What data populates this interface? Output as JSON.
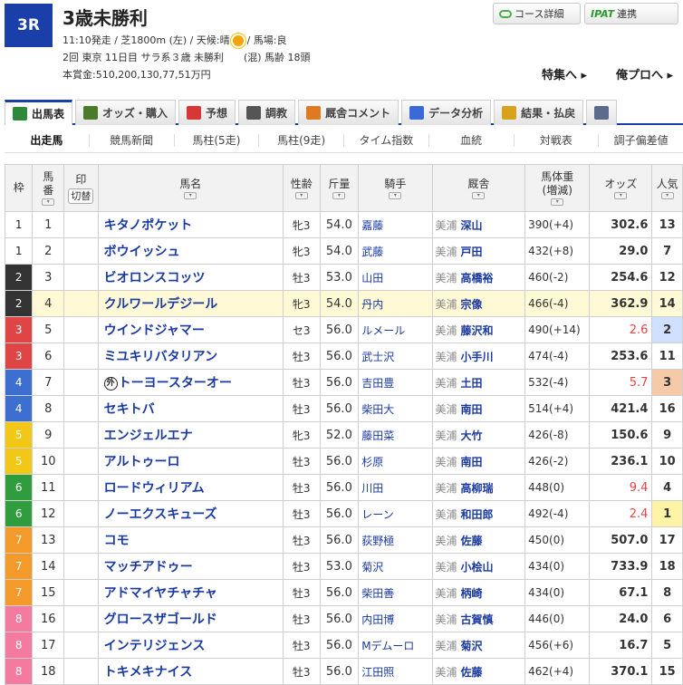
{
  "header": {
    "race_number": "3R",
    "race_name": "3歳未勝利",
    "buttons": {
      "course_detail": "コース詳細",
      "ipat_logo": "IPAT",
      "ipat_label": "連携"
    },
    "info_line1_a": "11:10発走 / 芝1800m (左) / 天候:晴",
    "info_line1_b": "/ 馬場:良",
    "info_line2": "2回 東京 11日目 サラ系３歳 未勝利　　(混) 馬齢 18頭",
    "info_line3": "本賞金:510,200,130,77,51万円",
    "links": {
      "tokushu": "特集へ",
      "orepro": "俺プロへ"
    }
  },
  "tabs": [
    {
      "label": "出馬表",
      "icon": "table-icon",
      "icon_color": "#2c8a3a"
    },
    {
      "label": "オッズ・購入",
      "icon": "odds-icon",
      "icon_color": "#4a7a2a"
    },
    {
      "label": "予想",
      "icon": "target-icon",
      "icon_color": "#d93636"
    },
    {
      "label": "調教",
      "icon": "stopwatch-icon",
      "icon_color": "#555555"
    },
    {
      "label": "厩舎コメント",
      "icon": "barn-icon",
      "icon_color": "#e07a22"
    },
    {
      "label": "データ分析",
      "icon": "bar-chart-icon",
      "icon_color": "#3a6ad8"
    },
    {
      "label": "結果・払戻",
      "icon": "coins-icon",
      "icon_color": "#d8a21c"
    },
    {
      "label": "",
      "icon": "video-icon",
      "icon_color": "#5a6a8a"
    }
  ],
  "subnav": [
    "出走馬",
    "競馬新聞",
    "馬柱(5走)",
    "馬柱(9走)",
    "タイム指数",
    "血統",
    "対戦表",
    "調子偏差値"
  ],
  "table": {
    "headers": {
      "waku": "枠",
      "umaban_1": "馬",
      "umaban_2": "番",
      "mark_1": "印",
      "mark_2": "切替",
      "horse": "馬名",
      "sexage": "性齢",
      "kinryo": "斤量",
      "jockey": "騎手",
      "trainer": "厩舎",
      "weight_1": "馬体重",
      "weight_2": "(増減)",
      "odds": "オッズ",
      "pop": "人気"
    },
    "rows": [
      {
        "waku": "1",
        "umaban": "1",
        "horse": "キタノポケット",
        "sexage": "牝3",
        "kinryo": "54.0",
        "jockey": "嘉藤",
        "region": "美浦",
        "trainer": "深山",
        "weight": "390(+4)",
        "odds": "302.6",
        "pop": "13"
      },
      {
        "waku": "1",
        "umaban": "2",
        "horse": "ボウイッシュ",
        "sexage": "牝3",
        "kinryo": "54.0",
        "jockey": "武藤",
        "region": "美浦",
        "trainer": "戸田",
        "weight": "432(+8)",
        "odds": "29.0",
        "pop": "7"
      },
      {
        "waku": "2",
        "umaban": "3",
        "horse": "ビオロンスコッツ",
        "sexage": "牡3",
        "kinryo": "53.0",
        "jockey": "山田",
        "region": "美浦",
        "trainer": "高橋裕",
        "weight": "460(-2)",
        "odds": "254.6",
        "pop": "12"
      },
      {
        "waku": "2",
        "umaban": "4",
        "horse": "クルワールデジール",
        "sexage": "牝3",
        "kinryo": "54.0",
        "jockey": "丹内",
        "region": "美浦",
        "trainer": "宗像",
        "weight": "466(-4)",
        "odds": "362.9",
        "pop": "14"
      },
      {
        "waku": "3",
        "umaban": "5",
        "horse": "ウインドジャマー",
        "sexage": "セ3",
        "kinryo": "56.0",
        "jockey": "ルメール",
        "region": "美浦",
        "trainer": "藤沢和",
        "weight": "490(+14)",
        "odds": "2.6",
        "pop": "2"
      },
      {
        "waku": "3",
        "umaban": "6",
        "horse": "ミユキリバタリアン",
        "sexage": "牡3",
        "kinryo": "56.0",
        "jockey": "武士沢",
        "region": "美浦",
        "trainer": "小手川",
        "weight": "474(-4)",
        "odds": "253.6",
        "pop": "11"
      },
      {
        "waku": "4",
        "umaban": "7",
        "horse": "トーヨースターオー",
        "sexage": "牡3",
        "kinryo": "56.0",
        "jockey": "吉田豊",
        "region": "美浦",
        "trainer": "土田",
        "weight": "532(-4)",
        "odds": "5.7",
        "pop": "3",
        "foreign": "外"
      },
      {
        "waku": "4",
        "umaban": "8",
        "horse": "セキトバ",
        "sexage": "牡3",
        "kinryo": "56.0",
        "jockey": "柴田大",
        "region": "美浦",
        "trainer": "南田",
        "weight": "514(+4)",
        "odds": "421.4",
        "pop": "16"
      },
      {
        "waku": "5",
        "umaban": "9",
        "horse": "エンジェルエナ",
        "sexage": "牝3",
        "kinryo": "52.0",
        "jockey": "藤田菜",
        "region": "美浦",
        "trainer": "大竹",
        "weight": "426(-8)",
        "odds": "150.6",
        "pop": "9"
      },
      {
        "waku": "5",
        "umaban": "10",
        "horse": "アルトゥーロ",
        "sexage": "牡3",
        "kinryo": "56.0",
        "jockey": "杉原",
        "region": "美浦",
        "trainer": "南田",
        "weight": "426(-2)",
        "odds": "236.1",
        "pop": "10"
      },
      {
        "waku": "6",
        "umaban": "11",
        "horse": "ロードウィリアム",
        "sexage": "牡3",
        "kinryo": "56.0",
        "jockey": "川田",
        "region": "美浦",
        "trainer": "高柳瑞",
        "weight": "448(0)",
        "odds": "9.4",
        "pop": "4"
      },
      {
        "waku": "6",
        "umaban": "12",
        "horse": "ノーエクスキューズ",
        "sexage": "牡3",
        "kinryo": "56.0",
        "jockey": "レーン",
        "region": "美浦",
        "trainer": "和田郎",
        "weight": "492(-4)",
        "odds": "2.4",
        "pop": "1"
      },
      {
        "waku": "7",
        "umaban": "13",
        "horse": "コモ",
        "sexage": "牡3",
        "kinryo": "56.0",
        "jockey": "荻野極",
        "region": "美浦",
        "trainer": "佐藤",
        "weight": "450(0)",
        "odds": "507.0",
        "pop": "17"
      },
      {
        "waku": "7",
        "umaban": "14",
        "horse": "マッチアドゥー",
        "sexage": "牡3",
        "kinryo": "53.0",
        "jockey": "菊沢",
        "region": "美浦",
        "trainer": "小桧山",
        "weight": "434(0)",
        "odds": "733.9",
        "pop": "18"
      },
      {
        "waku": "7",
        "umaban": "15",
        "horse": "アドマイヤチャチャ",
        "sexage": "牡3",
        "kinryo": "56.0",
        "jockey": "柴田善",
        "region": "美浦",
        "trainer": "柄崎",
        "weight": "434(0)",
        "odds": "67.1",
        "pop": "8"
      },
      {
        "waku": "8",
        "umaban": "16",
        "horse": "グロースザゴールド",
        "sexage": "牡3",
        "kinryo": "56.0",
        "jockey": "内田博",
        "region": "美浦",
        "trainer": "古賀慎",
        "weight": "446(0)",
        "odds": "24.0",
        "pop": "6"
      },
      {
        "waku": "8",
        "umaban": "17",
        "horse": "インテリジェンス",
        "sexage": "牡3",
        "kinryo": "56.0",
        "jockey": "Mデムーロ",
        "region": "美浦",
        "trainer": "菊沢",
        "weight": "456(+6)",
        "odds": "16.7",
        "pop": "5"
      },
      {
        "waku": "8",
        "umaban": "18",
        "horse": "トキメキナイス",
        "sexage": "牡3",
        "kinryo": "56.0",
        "jockey": "江田照",
        "region": "美浦",
        "trainer": "佐藤",
        "weight": "462(+4)",
        "odds": "370.1",
        "pop": "15"
      }
    ],
    "highlight_row": "4",
    "waku_colors": {
      "1": {
        "bg": "#ffffff",
        "fg": "#222222"
      },
      "2": {
        "bg": "#333333",
        "fg": "#ffffff"
      },
      "3": {
        "bg": "#e04545",
        "fg": "#ffffff"
      },
      "4": {
        "bg": "#3d6fd0",
        "fg": "#ffffff"
      },
      "5": {
        "bg": "#f2c716",
        "fg": "#ffffff"
      },
      "6": {
        "bg": "#2f9c3d",
        "fg": "#ffffff"
      },
      "7": {
        "bg": "#f39a2a",
        "fg": "#ffffff"
      },
      "8": {
        "bg": "#f47aa0",
        "fg": "#ffffff"
      }
    },
    "pop_colors": {
      "1": "#fff3a6",
      "2": "#cfe0ff",
      "3": "#f6c9a8"
    },
    "hot_odds_color": "#e04545"
  }
}
